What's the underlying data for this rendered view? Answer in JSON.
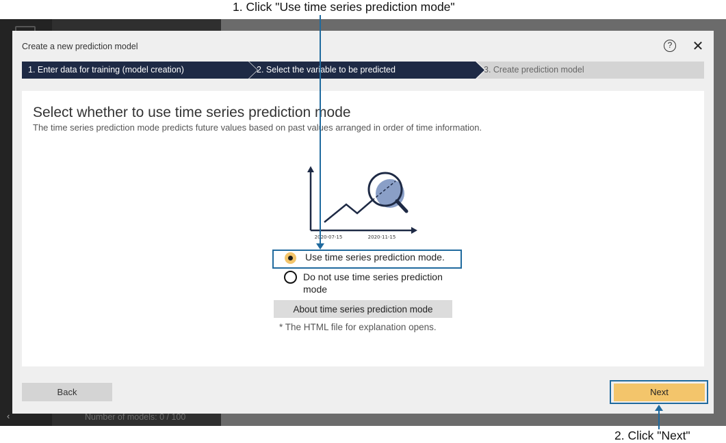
{
  "dialog": {
    "title": "Create a new prediction model",
    "steps": [
      {
        "label": "1. Enter data for training (model creation)"
      },
      {
        "label": "2. Select the variable to be predicted"
      },
      {
        "label": "3. Create prediction model"
      }
    ],
    "heading": "Select whether to use time series prediction mode",
    "description": "The time series prediction mode predicts future values based on past values arranged in order of time information.",
    "illustration": {
      "date_left": "2020-07-15",
      "date_right": "2020-11-15"
    },
    "options": [
      {
        "label": "Use time series prediction mode.",
        "selected": true
      },
      {
        "label": "Do not use time series prediction mode",
        "selected": false
      }
    ],
    "about_button": "About time series prediction mode",
    "note": "* The HTML file for explanation opens.",
    "back_button": "Back",
    "next_button": "Next",
    "help_icon_glyph": "?",
    "close_icon_glyph": "✕"
  },
  "background": {
    "models_count": "Number of models: 0 / 100"
  },
  "annotations": {
    "step1": "1. Click \"Use time series prediction mode\"",
    "step2": "2. Click \"Next\""
  },
  "colors": {
    "step_active": "#1e2a45",
    "step_inactive": "#d4d4d4",
    "accent": "#f3c56b",
    "annotation": "#1f6a9e"
  }
}
